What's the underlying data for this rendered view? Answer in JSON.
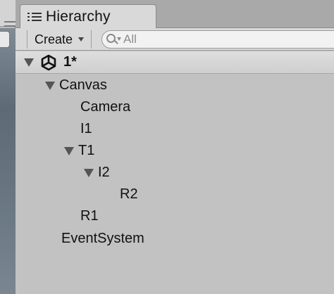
{
  "window": {
    "tab_title": "Hierarchy",
    "tab_icon": "list-icon"
  },
  "toolbar": {
    "create_label": "Create",
    "search_placeholder": "All"
  },
  "scene": {
    "name": "1*",
    "icon": "unity-logo-icon",
    "expanded": true
  },
  "tree": [
    {
      "label": "Canvas",
      "expanded": true
    },
    {
      "label": "Camera"
    },
    {
      "label": "I1"
    },
    {
      "label": "T1",
      "expanded": true
    },
    {
      "label": "I2",
      "expanded": true
    },
    {
      "label": "R2"
    },
    {
      "label": "R1"
    },
    {
      "label": "EventSystem"
    }
  ],
  "colors": {
    "panel_bg": "#c2c2c2",
    "tab_bg": "#d9d9d9",
    "text": "#111111"
  }
}
